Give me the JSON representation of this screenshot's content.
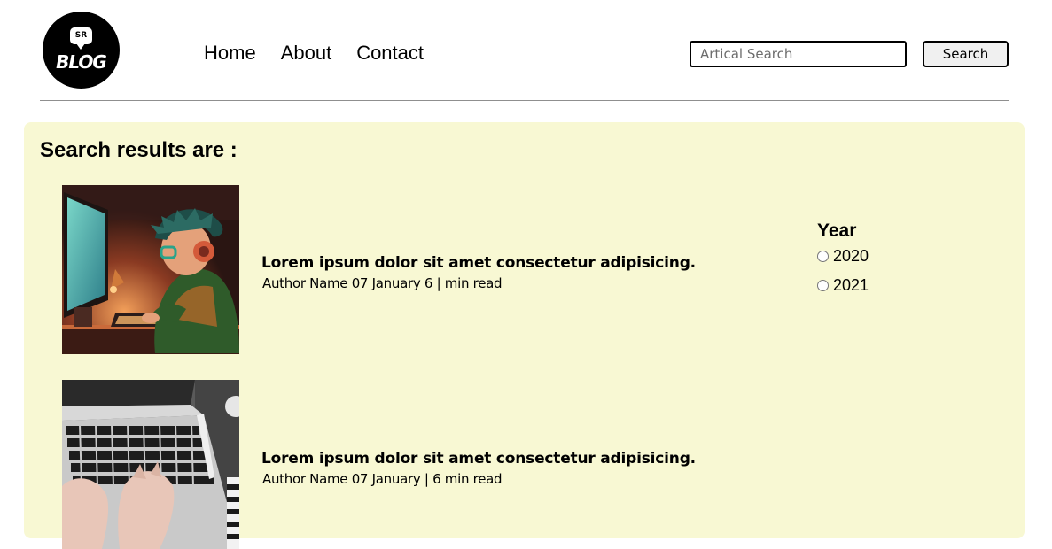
{
  "logo": {
    "badge_text": "SR",
    "word": "BLOG"
  },
  "nav": {
    "items": [
      {
        "label": "Home"
      },
      {
        "label": "About"
      },
      {
        "label": "Contact"
      }
    ]
  },
  "search": {
    "placeholder": "Artical Search",
    "value": "",
    "button_label": "Search"
  },
  "results": {
    "heading": "Search results are :",
    "items": [
      {
        "title": "Lorem ipsum dolor sit amet consectetur adipisicing.",
        "meta": "Author Name 07 January 6 | min read",
        "image": "gamer-at-computer-illustration"
      },
      {
        "title": "Lorem ipsum dolor sit amet consectetur adipisicing.",
        "meta": "Author Name 07 January | 6 min read",
        "image": "hands-typing-on-laptop-photo"
      }
    ]
  },
  "filter": {
    "title": "Year",
    "options": [
      {
        "label": "2020",
        "checked": false
      },
      {
        "label": "2021",
        "checked": false
      }
    ]
  },
  "colors": {
    "panel_background": "#f8f8d3",
    "divider": "#8f8f8f",
    "button_background": "#f0f0f0"
  }
}
